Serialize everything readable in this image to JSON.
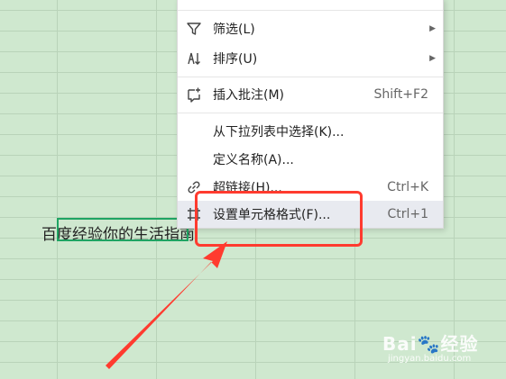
{
  "sheet": {
    "cell_text": "百度经验你的生活指南"
  },
  "context_menu": {
    "items": [
      {
        "icon": "filter-icon",
        "label": "筛选(L)",
        "has_submenu": true
      },
      {
        "icon": "sort-icon",
        "label": "排序(U)",
        "has_submenu": true
      },
      {
        "icon": "comment-icon",
        "label": "插入批注(M)",
        "shortcut": "Shift+F2"
      },
      {
        "label": "从下拉列表中选择(K)..."
      },
      {
        "label": "定义名称(A)..."
      },
      {
        "icon": "link-icon",
        "label": "超链接(H)...",
        "shortcut": "Ctrl+K"
      },
      {
        "icon": "format-cells-icon",
        "label": "设置单元格格式(F)...",
        "shortcut": "Ctrl+1",
        "hovered": true
      }
    ]
  },
  "annotation": {
    "box_color": "#ff3b2f",
    "arrow_color": "#ff3b2f"
  },
  "watermark": {
    "brand": "Bai",
    "brand_suffix": "经验",
    "url": "jingyan.baidu.com"
  }
}
